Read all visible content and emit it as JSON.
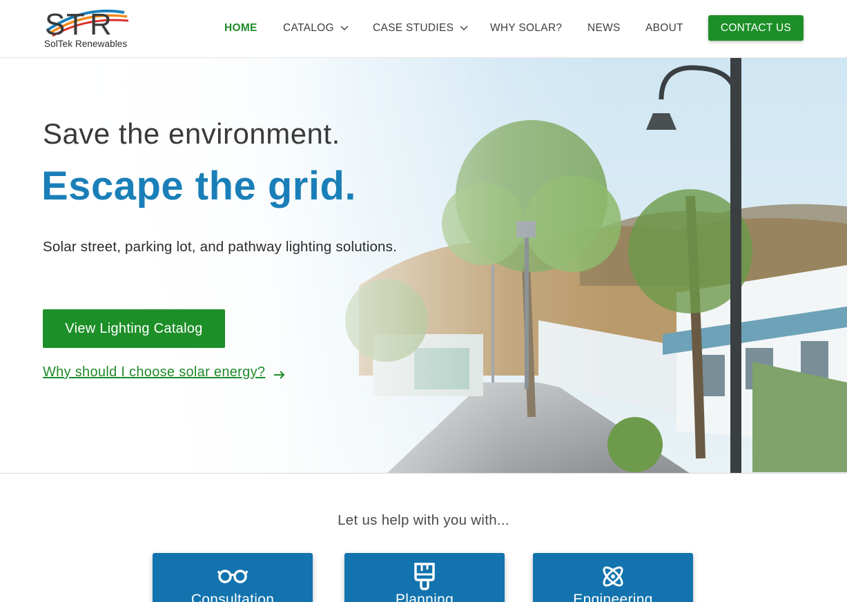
{
  "brand": {
    "logo_text": "SolTek Renewables",
    "logo_mark": "STR",
    "colors": {
      "blue": "#1a7fb8",
      "green": "#1d8f28",
      "orange": "#f08a1c",
      "red": "#d9302c"
    }
  },
  "nav": {
    "items": [
      {
        "label": "HOME",
        "active": true
      },
      {
        "label": "CATALOG",
        "has_dropdown": true
      },
      {
        "label": "CASE STUDIES",
        "has_dropdown": true
      },
      {
        "label": "WHY SOLAR?"
      },
      {
        "label": "NEWS"
      },
      {
        "label": "ABOUT"
      }
    ],
    "contact_label": "CONTACT US"
  },
  "hero": {
    "headline": "Save the environment.",
    "tagline": "Escape the grid.",
    "subtitle": "Solar street, parking lot, and pathway lighting solutions.",
    "cta_label": "View Lighting Catalog",
    "link_label": "Why should I choose solar energy?",
    "link_icon": "arrow-right-icon"
  },
  "services": {
    "title": "Let us help with you with...",
    "cards": [
      {
        "label": "Consultation",
        "icon": "glasses-icon"
      },
      {
        "label": "Planning",
        "icon": "paint-brush-icon"
      },
      {
        "label": "Engineering",
        "icon": "atom-icon"
      }
    ]
  }
}
